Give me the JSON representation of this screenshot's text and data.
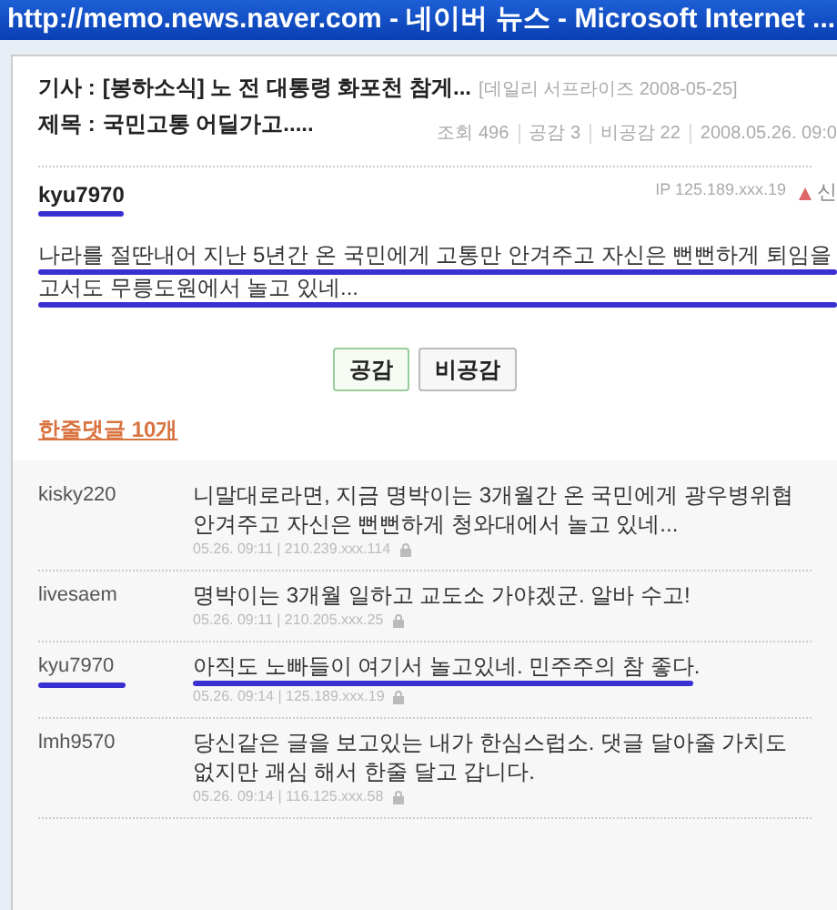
{
  "window": {
    "title": "http://memo.news.naver.com - 네이버 뉴스 - Microsoft Internet ..."
  },
  "article": {
    "label": "기사 :",
    "headline": "[봉하소식] 노 전 대통령 화포천 참게...",
    "source": "[데일리 서프라이즈 2008-05-25]"
  },
  "subject": {
    "label": "제목 :",
    "text": "국민고통 어딜가고.....",
    "stats": [
      "조회 496",
      "공감 3",
      "비공감 22",
      "2008.05.26. 09:0"
    ]
  },
  "post": {
    "author": "kyu7970",
    "author_marked": true,
    "ip": "IP 125.189.xxx.19",
    "report": "신",
    "lines": [
      {
        "text": "나라를 절딴내어 지난 5년간 온 국민에게 고통만 안겨주고 자신은 뻔뻔하게 퇴임을",
        "marked": true
      },
      {
        "text": "고서도 무릉도원에서 놀고 있네...",
        "marked": true
      }
    ]
  },
  "buttons": [
    {
      "label": "공감",
      "selected": true
    },
    {
      "label": "비공감",
      "selected": false
    }
  ],
  "comments_heading": "한줄댓글 10개",
  "comments": [
    {
      "user": "kisky220",
      "text": "니말대로라면, 지금 명박이는 3개월간 온 국민에게 광우병위협 안겨주고 자신은 뻔뻔하게 청와대에서 놀고 있네...",
      "meta": "05.26. 09:11 | 210.239.xxx.114",
      "marked": false
    },
    {
      "user": "livesaem",
      "text": "명박이는 3개월 일하고 교도소 가야겠군. 알바 수고!",
      "meta": "05.26. 09:11 | 210.205.xxx.25",
      "marked": false
    },
    {
      "user": "kyu7970",
      "text": "아직도 노빠들이 여기서 놀고있네. 민주주의 참 좋다.",
      "meta": "05.26. 09:14 | 125.189.xxx.19",
      "marked": true
    },
    {
      "user": "lmh9570",
      "text": "당신같은 글을 보고있는 내가 한심스럽소. 댓글 달아줄 가치도 없지만 괘심 해서 한줄 달고 갑니다.",
      "meta": "05.26. 09:14 | 116.125.xxx.58",
      "marked": false
    }
  ]
}
